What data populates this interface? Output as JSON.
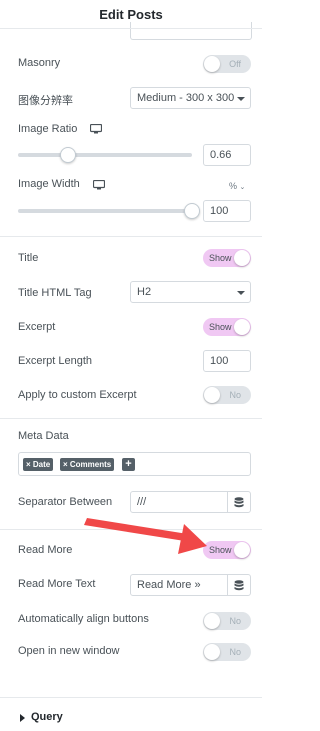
{
  "header": {
    "title": "Edit Posts"
  },
  "settings": {
    "masonry": {
      "label": "Masonry",
      "state": "Off"
    },
    "image_resolution": {
      "label": "图像分辨率",
      "value": "Medium - 300 x 300"
    },
    "image_ratio": {
      "label": "Image Ratio",
      "value": "0.66",
      "slider_fraction": 0.29
    },
    "image_width": {
      "label": "Image Width",
      "value": "100",
      "unit": "%",
      "slider_fraction": 1.0
    },
    "title": {
      "label": "Title",
      "state": "Show"
    },
    "title_tag": {
      "label": "Title HTML Tag",
      "value": "H2"
    },
    "excerpt": {
      "label": "Excerpt",
      "state": "Show"
    },
    "excerpt_length": {
      "label": "Excerpt Length",
      "value": "100"
    },
    "custom_excerpt": {
      "label": "Apply to custom Excerpt",
      "state": "No"
    },
    "meta_data": {
      "label": "Meta Data",
      "tags": [
        "× Date",
        "× Comments"
      ],
      "add": "+"
    },
    "separator": {
      "label": "Separator Between",
      "value": "///"
    },
    "read_more": {
      "label": "Read More",
      "state": "Show"
    },
    "read_more_text": {
      "label": "Read More Text",
      "value": "Read More »"
    },
    "align_buttons": {
      "label": "Automatically align buttons",
      "state": "No"
    },
    "new_window": {
      "label": "Open in new window",
      "state": "No"
    }
  },
  "sections": {
    "query": "Query"
  },
  "colors": {
    "toggle_on": "#f0c8f3",
    "toggle_off": "#e0e4e8",
    "annotation_arrow": "#f04848"
  },
  "icons": {
    "responsive": "monitor-icon",
    "dynamic": "database-icon"
  }
}
